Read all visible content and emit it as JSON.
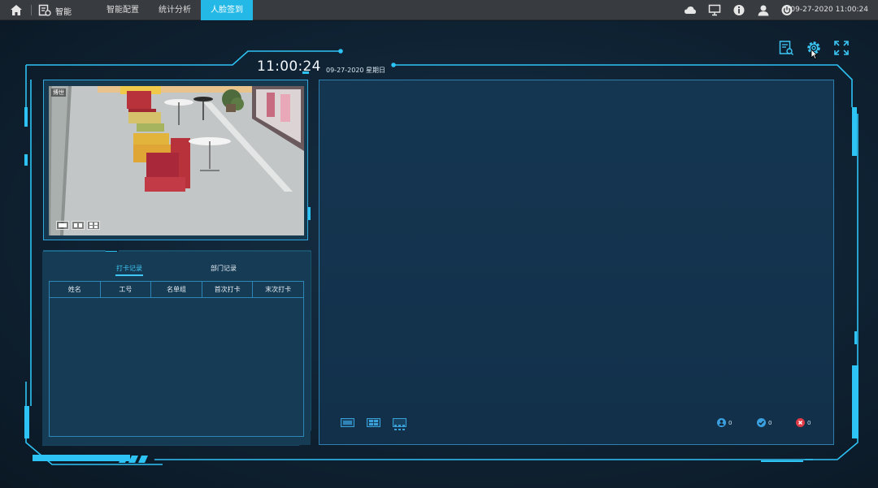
{
  "topbar": {
    "app_label": "智能",
    "tabs": [
      {
        "label": "智能配置",
        "active": false
      },
      {
        "label": "统计分析",
        "active": false
      },
      {
        "label": "人脸签到",
        "active": true
      }
    ],
    "right_icons": [
      "cloud-icon",
      "monitor-icon",
      "info-icon",
      "user-icon",
      "power-icon"
    ],
    "datetime": "09-27-2020 11:00:24"
  },
  "header": {
    "time": "11:00:24",
    "date": "09-27-2020 星期日"
  },
  "toolbar_icons": [
    "search-record-icon",
    "gear-icon",
    "fullscreen-icon"
  ],
  "video": {
    "osd_text": "博世",
    "layouts": [
      "single-layout-icon",
      "dual-layout-icon",
      "quad-layout-icon"
    ]
  },
  "records": {
    "tabs": [
      {
        "label": "打卡记录",
        "active": true
      },
      {
        "label": "部门记录",
        "active": false
      }
    ],
    "columns": [
      "姓名",
      "工号",
      "名单组",
      "首次打卡",
      "末次打卡"
    ],
    "rows": []
  },
  "main": {
    "grid_layouts": [
      "grid-1-icon",
      "grid-4-icon",
      "grid-9-icon"
    ],
    "stats": {
      "person": "0",
      "passed": "0",
      "failed": "0"
    }
  },
  "colors": {
    "accent": "#23b8e6",
    "frame": "#2ec3f5",
    "passed": "#3aa0e0",
    "failed": "#e03a46"
  }
}
